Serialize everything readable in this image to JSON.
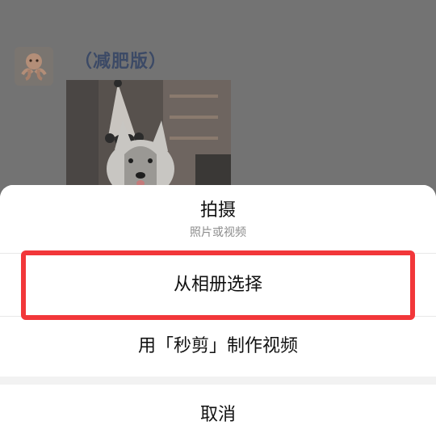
{
  "feed": {
    "post_name": "（减肥版）"
  },
  "action_sheet": {
    "shoot_label": "拍摄",
    "shoot_sublabel": "照片或视频",
    "album_label": "从相册选择",
    "video_label": "用「秒剪」制作视频",
    "cancel_label": "取消"
  },
  "colors": {
    "highlight": "#f2373a",
    "overlay": "#737373",
    "post_name": "#3c4a66"
  }
}
